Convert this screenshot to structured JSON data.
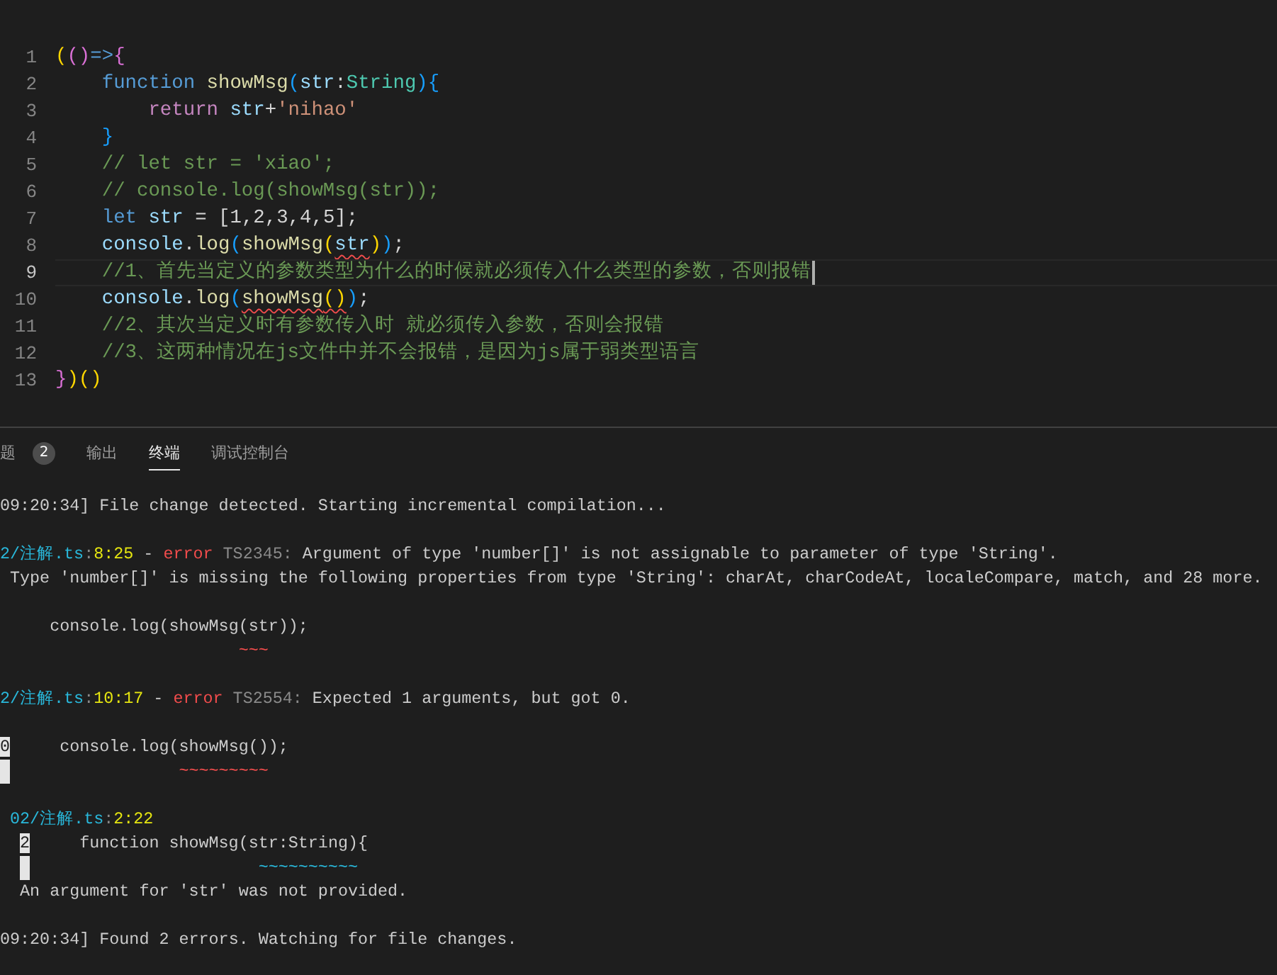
{
  "editor": {
    "lines": [
      {
        "number": "1",
        "current": false,
        "tokens": [
          {
            "text": "(",
            "kind": "bracket1"
          },
          {
            "text": "()",
            "kind": "bracket2"
          },
          {
            "text": "=>",
            "kind": "keyword"
          },
          {
            "text": "{",
            "kind": "bracket2"
          }
        ]
      },
      {
        "number": "2",
        "current": false,
        "tokens": [
          {
            "text": "    function ",
            "kind": "keyword"
          },
          {
            "text": "showMsg",
            "kind": "function"
          },
          {
            "text": "(",
            "kind": "bracket3"
          },
          {
            "text": "str",
            "kind": "variable"
          },
          {
            "text": ":",
            "kind": "plain"
          },
          {
            "text": "String",
            "kind": "type"
          },
          {
            "text": "){",
            "kind": "bracket3"
          }
        ]
      },
      {
        "number": "3",
        "current": false,
        "tokens": [
          {
            "text": "        return ",
            "kind": "control"
          },
          {
            "text": "str",
            "kind": "variable"
          },
          {
            "text": "+",
            "kind": "plain"
          },
          {
            "text": "'nihao'",
            "kind": "string"
          }
        ]
      },
      {
        "number": "4",
        "current": false,
        "tokens": [
          {
            "text": "    }",
            "kind": "bracket3"
          }
        ]
      },
      {
        "number": "5",
        "current": false,
        "tokens": [
          {
            "text": "    // let str = 'xiao';",
            "kind": "comment"
          }
        ]
      },
      {
        "number": "6",
        "current": false,
        "tokens": [
          {
            "text": "    // console.log(showMsg(str));",
            "kind": "comment"
          }
        ]
      },
      {
        "number": "7",
        "current": false,
        "tokens": [
          {
            "text": "    let ",
            "kind": "keyword"
          },
          {
            "text": "str",
            "kind": "variable"
          },
          {
            "text": " = [1,2,3,4,5];",
            "kind": "plain"
          }
        ]
      },
      {
        "number": "8",
        "current": false,
        "tokens": [
          {
            "text": "    console",
            "kind": "variable"
          },
          {
            "text": ".",
            "kind": "plain"
          },
          {
            "text": "log",
            "kind": "function"
          },
          {
            "text": "(",
            "kind": "bracket3"
          },
          {
            "text": "showMsg",
            "kind": "function"
          },
          {
            "text": "(",
            "kind": "bracket1"
          },
          {
            "text": "str",
            "kind": "variable",
            "error": true
          },
          {
            "text": ")",
            "kind": "bracket1"
          },
          {
            "text": ")",
            "kind": "bracket3"
          },
          {
            "text": ";",
            "kind": "plain"
          }
        ]
      },
      {
        "number": "9",
        "current": true,
        "tokens": [
          {
            "text": "    //1、首先当定义的参数类型为什么的时候就必须传入什么类型的参数，否则报错",
            "kind": "comment"
          }
        ]
      },
      {
        "number": "10",
        "current": false,
        "tokens": [
          {
            "text": "    console",
            "kind": "variable"
          },
          {
            "text": ".",
            "kind": "plain"
          },
          {
            "text": "log",
            "kind": "function"
          },
          {
            "text": "(",
            "kind": "bracket3"
          },
          {
            "text": "showMsg",
            "kind": "function",
            "error": true
          },
          {
            "text": "()",
            "kind": "bracket1",
            "error": true
          },
          {
            "text": ")",
            "kind": "bracket3"
          },
          {
            "text": ";",
            "kind": "plain"
          }
        ]
      },
      {
        "number": "11",
        "current": false,
        "tokens": [
          {
            "text": "    //2、其次当定义时有参数传入时 就必须传入参数，否则会报错",
            "kind": "comment"
          }
        ]
      },
      {
        "number": "12",
        "current": false,
        "tokens": [
          {
            "text": "    //3、这两种情况在js文件中并不会报错，是因为js属于弱类型语言",
            "kind": "comment"
          }
        ]
      },
      {
        "number": "13",
        "current": false,
        "tokens": [
          {
            "text": "}",
            "kind": "bracket2"
          },
          {
            "text": ")()",
            "kind": "bracket1"
          }
        ]
      }
    ]
  },
  "panel": {
    "tabs": [
      {
        "label": "题",
        "selected": false,
        "badge": "2"
      },
      {
        "label": "输出",
        "selected": false
      },
      {
        "label": "终端",
        "selected": true
      },
      {
        "label": "调试控制台",
        "selected": false
      }
    ]
  },
  "terminal": {
    "blocks": [
      {
        "lines": [
          [
            {
              "text": "09:20:34] File change detected. Starting incremental compilation...",
              "kind": "text"
            }
          ]
        ]
      },
      {
        "lines": [
          [
            {
              "text": "2/注解.ts",
              "kind": "path"
            },
            {
              "text": ":",
              "kind": "dim"
            },
            {
              "text": "8:25",
              "kind": "position"
            },
            {
              "text": " - ",
              "kind": "text"
            },
            {
              "text": "error",
              "kind": "error"
            },
            {
              "text": " TS2345:",
              "kind": "dim"
            },
            {
              "text": " Argument of type 'number[]' is not assignable to parameter of type 'String'.",
              "kind": "text"
            }
          ],
          [
            {
              "text": " Type 'number[]' is missing the following properties from type 'String': charAt, charCodeAt, localeCompare, match, and 28 more.",
              "kind": "text"
            }
          ]
        ]
      },
      {
        "lines": [
          [
            {
              "text": "     console.log(showMsg(str));",
              "kind": "text"
            }
          ],
          [
            {
              "text": "                        ~~~",
              "kind": "squiggle-error"
            }
          ]
        ]
      },
      {
        "lines": [
          [
            {
              "text": "2/注解.ts",
              "kind": "path"
            },
            {
              "text": ":",
              "kind": "dim"
            },
            {
              "text": "10:17",
              "kind": "position"
            },
            {
              "text": " - ",
              "kind": "text"
            },
            {
              "text": "error",
              "kind": "error"
            },
            {
              "text": " TS2554:",
              "kind": "dim"
            },
            {
              "text": " Expected 1 arguments, but got 0.",
              "kind": "text"
            }
          ]
        ]
      },
      {
        "lines": [
          [
            {
              "text": "0",
              "kind": "gutter",
              "indented": false
            },
            {
              "text": "     console.log(showMsg());",
              "kind": "text"
            }
          ],
          [
            {
              "kind": "gutter-blank",
              "indented": false
            },
            {
              "text": "                 ~~~~~~~~~",
              "kind": "squiggle-error"
            }
          ]
        ]
      },
      {
        "lines": [
          [
            {
              "text": " 02/注解.ts",
              "kind": "path"
            },
            {
              "text": ":",
              "kind": "dim"
            },
            {
              "text": "2:22",
              "kind": "position"
            }
          ],
          [
            {
              "text": "2",
              "kind": "gutter",
              "indented": true
            },
            {
              "text": "     function showMsg(str:String){",
              "kind": "text"
            }
          ],
          [
            {
              "kind": "gutter-blank",
              "indented": true
            },
            {
              "text": "                       ~~~~~~~~~~",
              "kind": "squiggle-info"
            }
          ],
          [
            {
              "text": "  An argument for 'str' was not provided.",
              "kind": "text"
            }
          ]
        ]
      },
      {
        "lines": [
          [
            {
              "text": "09:20:34] Found 2 errors. Watching for file changes.",
              "kind": "text"
            }
          ]
        ]
      }
    ]
  }
}
